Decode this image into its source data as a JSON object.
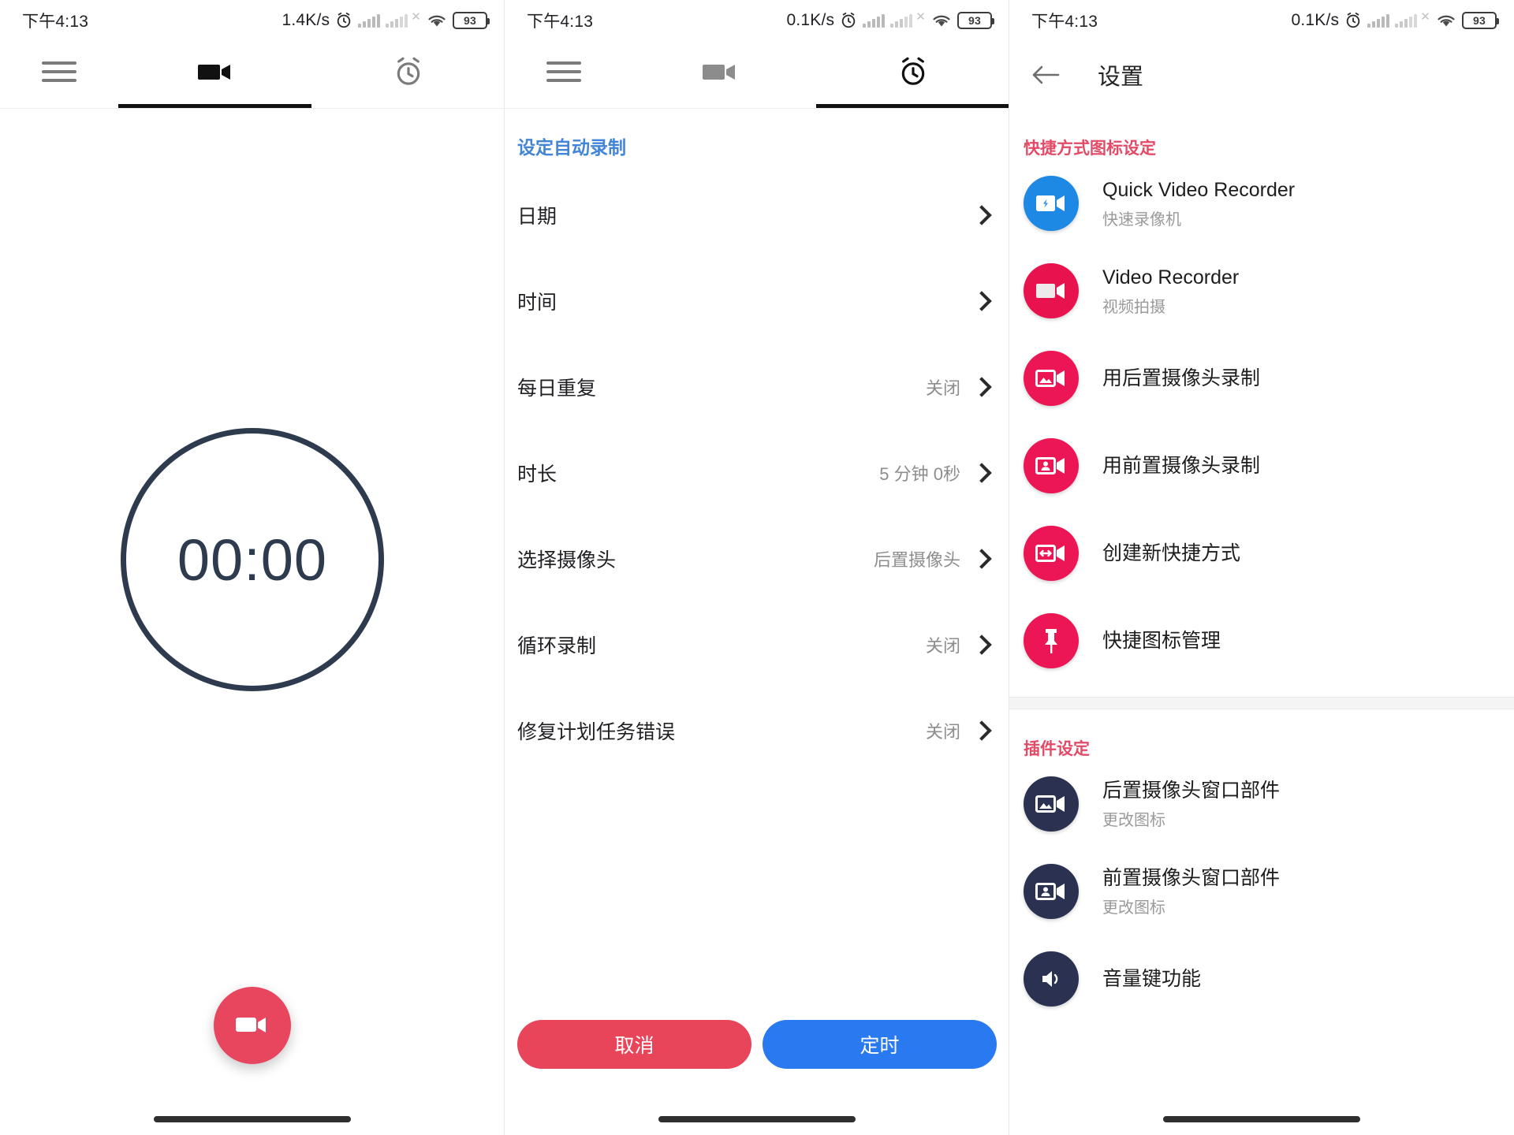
{
  "statusbar": {
    "left": {
      "time": "下午4:13",
      "speed": "1.4K/s",
      "battery": "93"
    },
    "middle": {
      "time": "下午4:13",
      "speed": "0.1K/s",
      "battery": "93"
    },
    "right": {
      "time": "下午4:13",
      "speed": "0.1K/s",
      "battery": "93"
    }
  },
  "tabs": {
    "video_label": "video-camera",
    "alarm_label": "alarm-clock",
    "menu_label": "menu"
  },
  "left_panel": {
    "timer": "00:00",
    "record_button": "record"
  },
  "middle_panel": {
    "title": "设定自动录制",
    "rows": [
      {
        "label": "日期",
        "value": ""
      },
      {
        "label": "时间",
        "value": ""
      },
      {
        "label": "每日重复",
        "value": "关闭"
      },
      {
        "label": "时长",
        "value": "5 分钟 0秒"
      },
      {
        "label": "选择摄像头",
        "value": "后置摄像头"
      },
      {
        "label": "循环录制",
        "value": "关闭"
      },
      {
        "label": "修复计划任务错误",
        "value": "关闭"
      }
    ],
    "cancel_label": "取消",
    "confirm_label": "定时"
  },
  "right_panel": {
    "app_title": "设置",
    "sections": [
      {
        "header": "快捷方式图标设定",
        "items": [
          {
            "title": "Quick Video Recorder",
            "subtitle": "快速录像机",
            "icon": "video-bolt-icon",
            "color": "#1e88e5"
          },
          {
            "title": "Video Recorder",
            "subtitle": "视频拍摄",
            "icon": "video-plain-icon",
            "color": "#e8134e"
          },
          {
            "title": "用后置摄像头录制",
            "subtitle": "",
            "icon": "video-photo-icon",
            "color": "#ec1655"
          },
          {
            "title": "用前置摄像头录制",
            "subtitle": "",
            "icon": "video-person-icon",
            "color": "#ec1655"
          },
          {
            "title": "创建新快捷方式",
            "subtitle": "",
            "icon": "video-arrows-icon",
            "color": "#ec1655"
          },
          {
            "title": "快捷图标管理",
            "subtitle": "",
            "icon": "pin-icon",
            "color": "#ec1655"
          }
        ]
      },
      {
        "header": "插件设定",
        "items": [
          {
            "title": "后置摄像头窗口部件",
            "subtitle": "更改图标",
            "icon": "video-photo-icon",
            "color": "#2b3151"
          },
          {
            "title": "前置摄像头窗口部件",
            "subtitle": "更改图标",
            "icon": "video-person-icon",
            "color": "#2b3151"
          },
          {
            "title": "音量键功能",
            "subtitle": "",
            "icon": "volume-icon",
            "color": "#2b3151"
          }
        ]
      }
    ]
  }
}
